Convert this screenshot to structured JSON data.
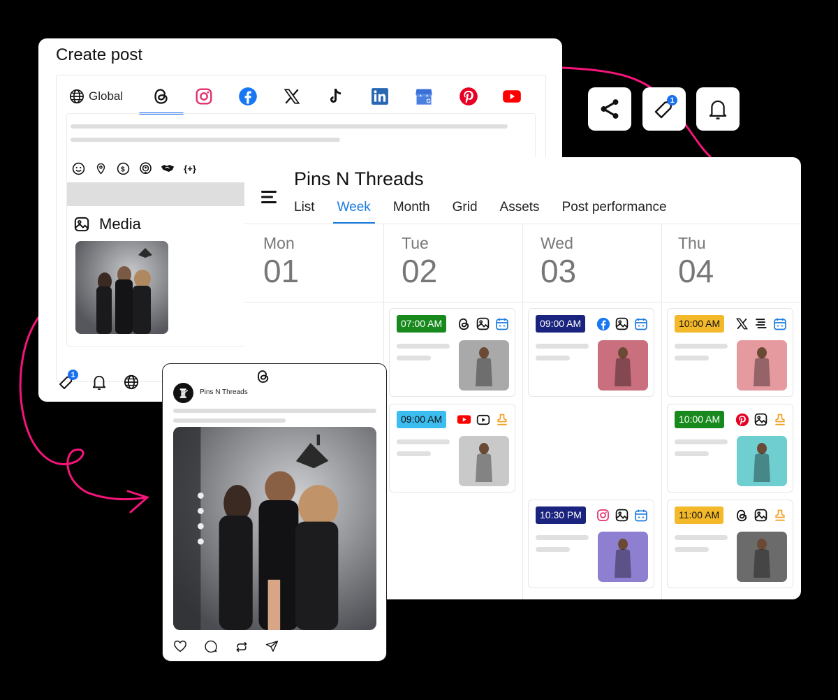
{
  "create_post": {
    "title": "Create post",
    "global_label": "Global",
    "networks": [
      "global",
      "threads",
      "instagram",
      "facebook",
      "x",
      "tiktok",
      "linkedin",
      "google-business",
      "pinterest",
      "youtube"
    ],
    "active_network": "threads",
    "toolbar_icons": [
      "emoji-icon",
      "location-icon",
      "dollar-icon",
      "podcast-icon",
      "handshake-icon",
      "variable-icon"
    ],
    "variable_glyph": "{+}",
    "media_label": "Media",
    "tag_badge_count": "1"
  },
  "floating_actions": {
    "share": "share-icon",
    "tag_badge_count": "1",
    "notification": "bell-icon"
  },
  "calendar": {
    "brand": "Pins N Threads",
    "tabs": [
      {
        "label": "List",
        "active": false
      },
      {
        "label": "Week",
        "active": true
      },
      {
        "label": "Month",
        "active": false
      },
      {
        "label": "Grid",
        "active": false
      },
      {
        "label": "Assets",
        "active": false
      },
      {
        "label": "Post performance",
        "active": false
      }
    ],
    "days": [
      {
        "name": "Mon",
        "date": "01"
      },
      {
        "name": "Tue",
        "date": "02"
      },
      {
        "name": "Wed",
        "date": "03"
      },
      {
        "name": "Thu",
        "date": "04"
      }
    ],
    "posts": [
      {
        "day": "Tue",
        "slot": 0,
        "time": "07:00 AM",
        "time_color": "#188a1d",
        "icons": [
          "threads",
          "image",
          "calendar"
        ],
        "thumb_color": "#a9a9a9"
      },
      {
        "day": "Tue",
        "slot": 1,
        "time": "09:00 AM",
        "time_color": "#3bbdf0",
        "time_text_color": "#111111",
        "icons": [
          "youtube",
          "video",
          "stamp"
        ],
        "thumb_color": "#c9c9c9"
      },
      {
        "day": "Wed",
        "slot": 0,
        "time": "09:00 AM",
        "time_color": "#1a237e",
        "icons": [
          "facebook",
          "image",
          "calendar"
        ],
        "thumb_color": "#c96f7d"
      },
      {
        "day": "Wed",
        "slot": 2,
        "time": "10:30 PM",
        "time_color": "#1a237e",
        "icons": [
          "instagram",
          "image",
          "calendar"
        ],
        "thumb_color": "#8e7fd0"
      },
      {
        "day": "Thu",
        "slot": 0,
        "time": "10:00 AM",
        "time_color": "#f4b92a",
        "time_text_color": "#111111",
        "icons": [
          "x",
          "text",
          "calendar"
        ],
        "thumb_color": "#e59aa0"
      },
      {
        "day": "Thu",
        "slot": 1,
        "time": "10:00 AM",
        "time_color": "#188a1d",
        "icons": [
          "pinterest",
          "image",
          "stamp"
        ],
        "thumb_color": "#6fcfd0"
      },
      {
        "day": "Thu",
        "slot": 2,
        "time": "11:00 AM",
        "time_color": "#f4b92a",
        "time_text_color": "#111111",
        "icons": [
          "threads",
          "image",
          "stamp"
        ],
        "thumb_color": "#6b6b6b"
      }
    ]
  },
  "preview": {
    "network": "threads",
    "profile_name": "Pins N Threads",
    "actions": [
      "like-icon",
      "comment-icon",
      "repost-icon",
      "share-icon"
    ]
  },
  "colors": {
    "accent": "#1a6ef0",
    "tab_active": "#1a7ae0",
    "arrow": "#ff1a7a"
  }
}
